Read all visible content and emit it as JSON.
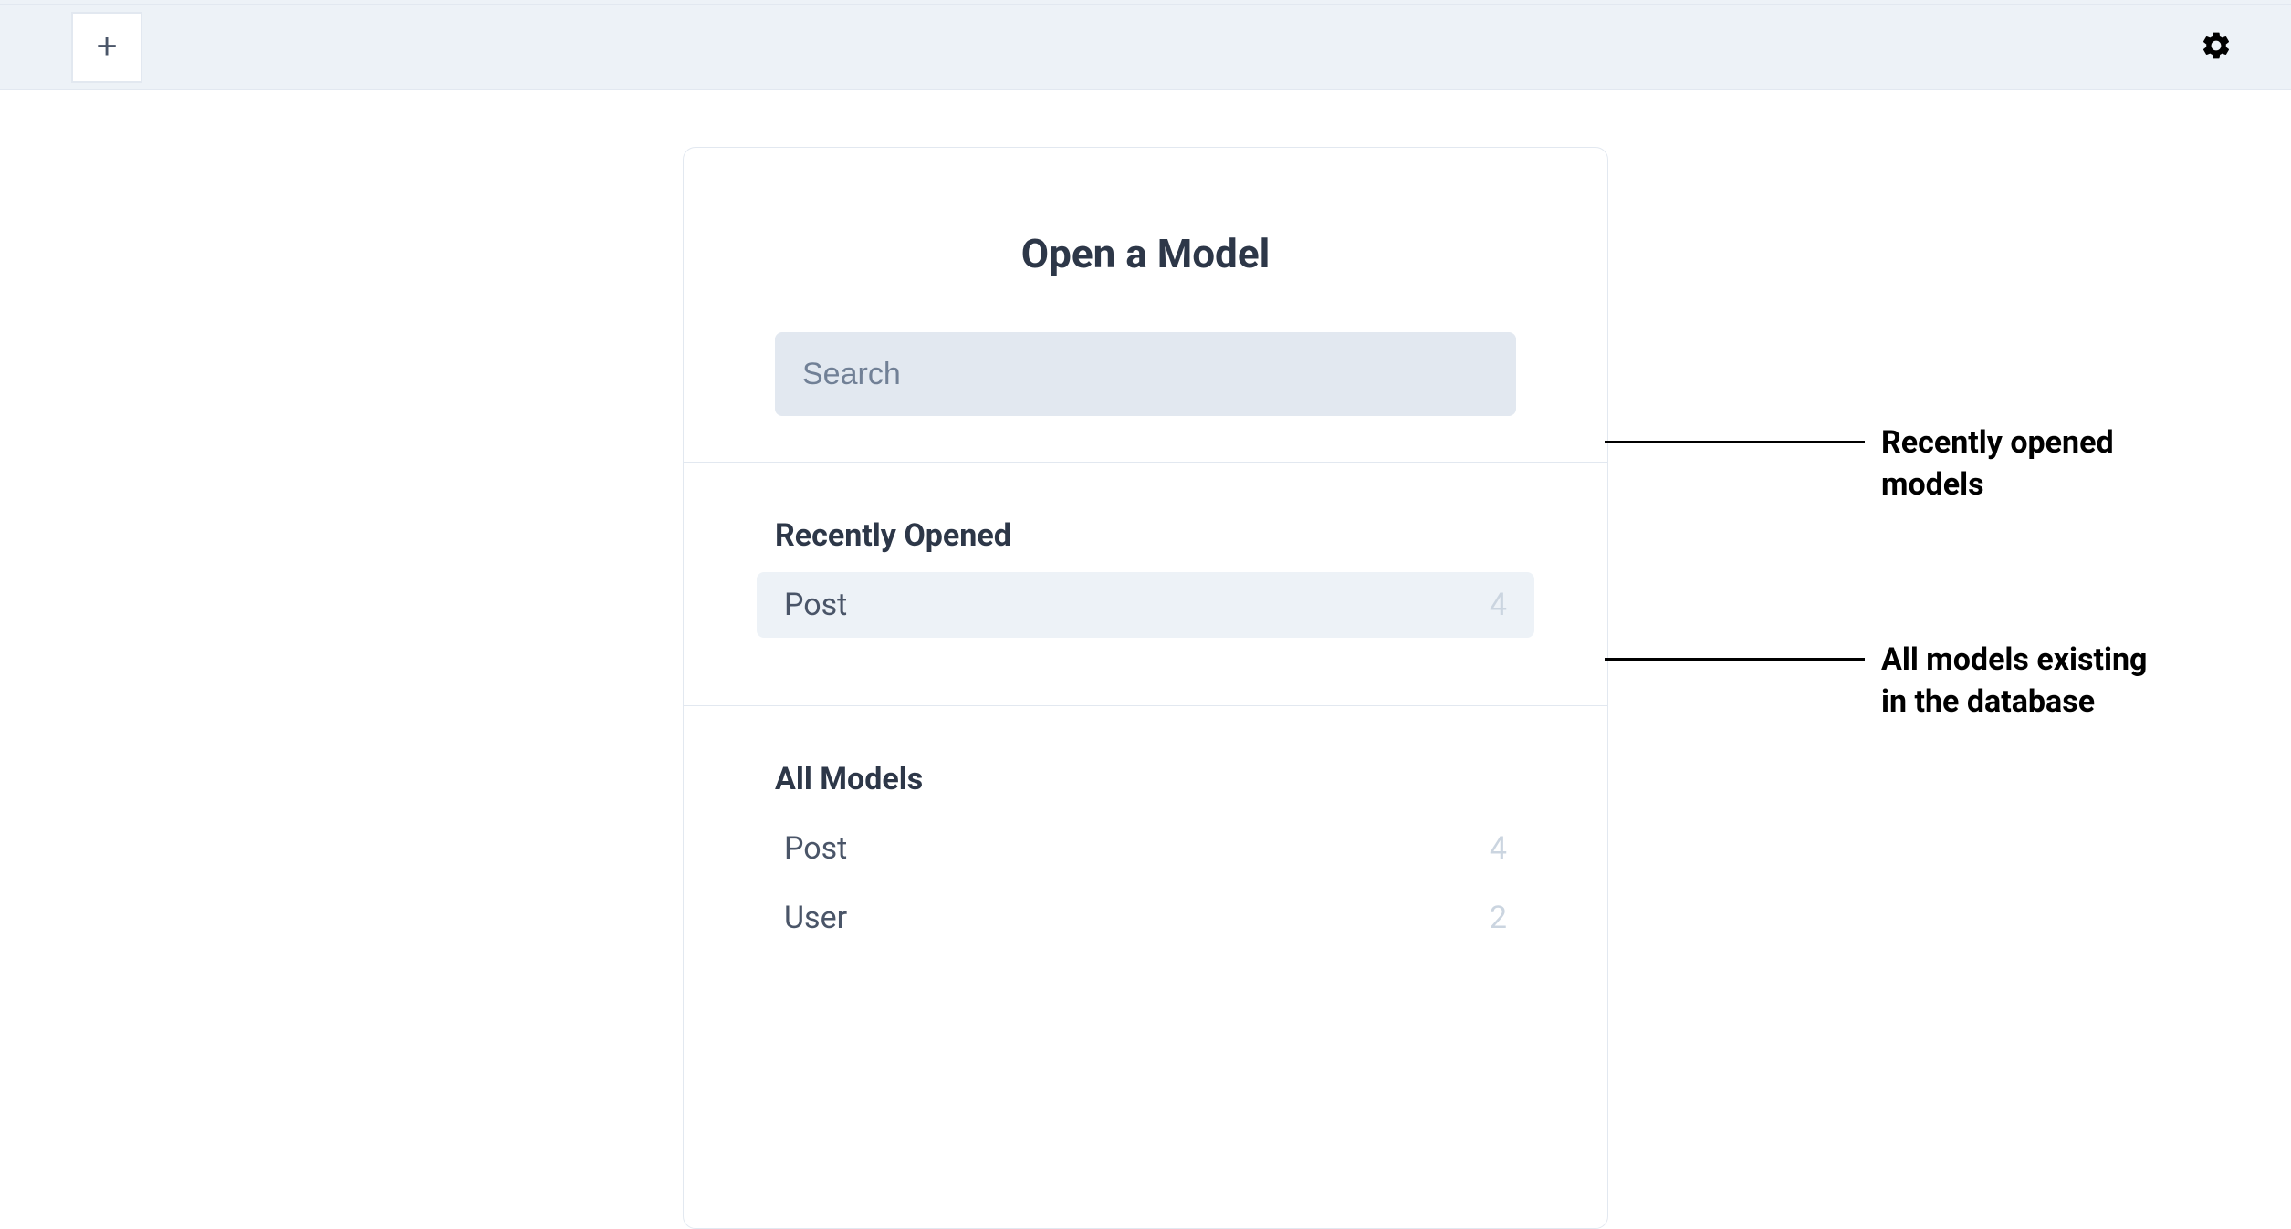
{
  "topbar": {
    "add_label": "+"
  },
  "modal": {
    "title": "Open a Model",
    "search_placeholder": "Search"
  },
  "recently_opened": {
    "title": "Recently Opened",
    "items": [
      {
        "name": "Post",
        "count": "4"
      }
    ]
  },
  "all_models": {
    "title": "All Models",
    "items": [
      {
        "name": "Post",
        "count": "4"
      },
      {
        "name": "User",
        "count": "2"
      }
    ]
  },
  "annotations": {
    "recently_opened": "Recently opened\nmodels",
    "all_models": "All models existing\nin the database"
  }
}
